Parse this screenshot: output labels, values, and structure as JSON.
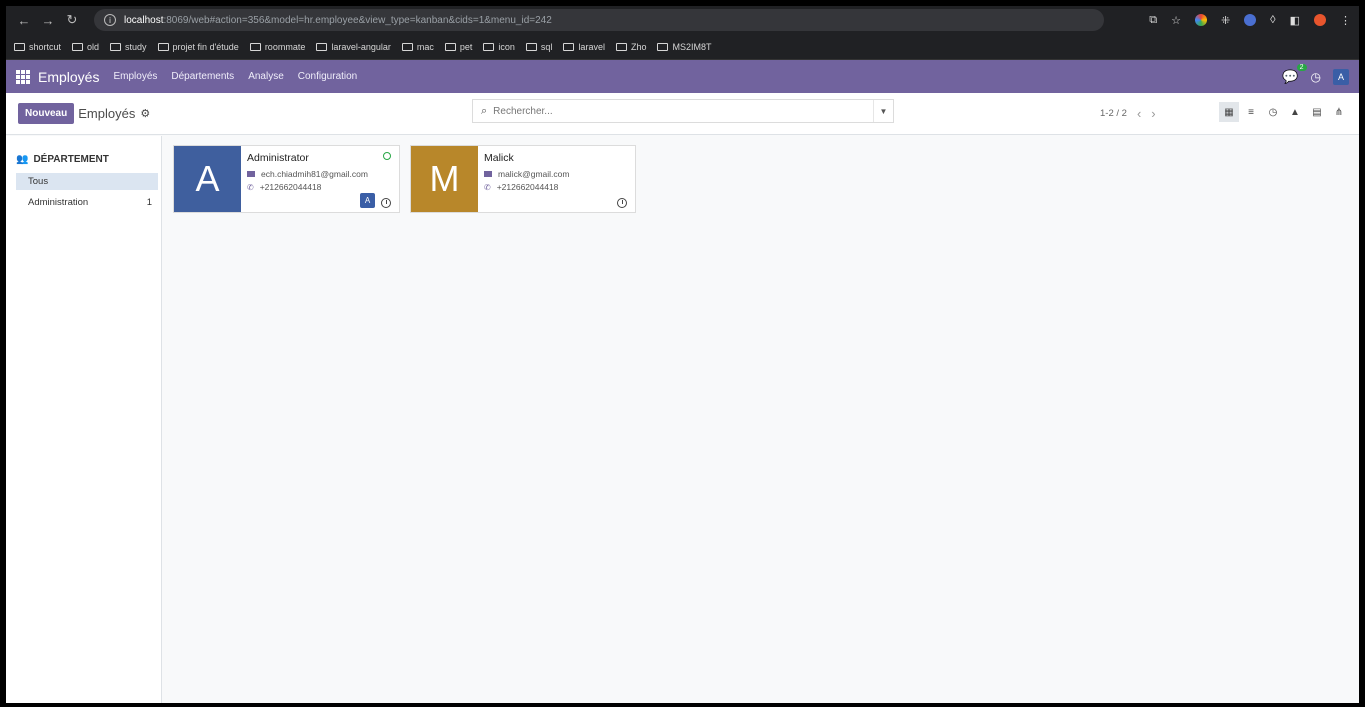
{
  "browser": {
    "url_host": "localhost",
    "url_rest": ":8069/web#action=356&model=hr.employee&view_type=kanban&cids=1&menu_id=242",
    "bookmarks": [
      "shortcut",
      "old",
      "study",
      "projet fin d'étude",
      "roommate",
      "laravel-angular",
      "mac",
      "pet",
      "icon",
      "sql",
      "laravel",
      "Zho",
      "MS2IM8T"
    ]
  },
  "navbar": {
    "app_name": "Employés",
    "menu": [
      "Employés",
      "Départements",
      "Analyse",
      "Configuration"
    ],
    "chat_count": "2",
    "user_initial": "A"
  },
  "control": {
    "new_label": "Nouveau",
    "title": "Employés",
    "search_placeholder": "Rechercher...",
    "pager": "1-2 / 2"
  },
  "side": {
    "heading": "DÉPARTEMENT",
    "items": [
      {
        "label": "Tous",
        "count": ""
      },
      {
        "label": "Administration",
        "count": "1"
      }
    ]
  },
  "employees": [
    {
      "initial": "A",
      "name": "Administrator",
      "email": "ech.chiadmih81@gmail.com",
      "phone": "+212662044418",
      "color": "#3f5f9e",
      "user_initial": "A"
    },
    {
      "initial": "M",
      "name": "Malick",
      "email": "malick@gmail.com",
      "phone": "+212662044418",
      "color": "#b8872a"
    }
  ]
}
